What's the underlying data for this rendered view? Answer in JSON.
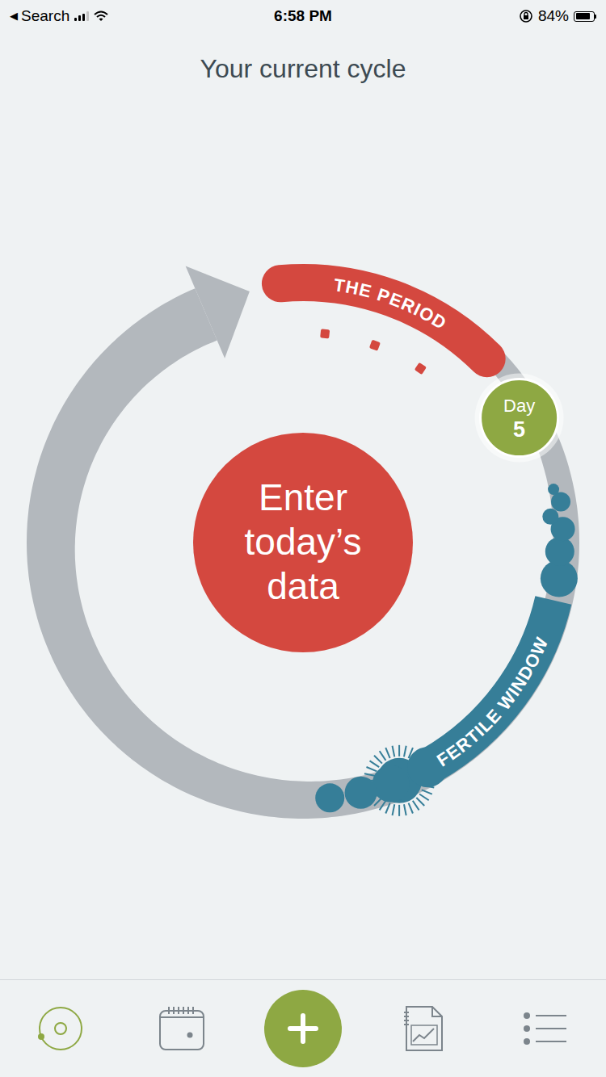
{
  "status_bar": {
    "back_icon": "◀",
    "back_label": "Search",
    "signal_bars": 3,
    "time": "6:58 PM",
    "battery_text": "84%",
    "battery_level": 0.84
  },
  "title": "Your current cycle",
  "cycle": {
    "period_label": "THE PERIOD",
    "fertile_label": "FERTILE WINDOW",
    "day_label": "Day",
    "day": "5",
    "enter_button": "Enter today’s data"
  },
  "tab_bar": [
    {
      "kind": "cycle",
      "selected": true
    },
    {
      "kind": "calendar",
      "selected": false
    },
    {
      "kind": "add",
      "selected": false
    },
    {
      "kind": "charts",
      "selected": false
    },
    {
      "kind": "menu",
      "selected": false
    }
  ]
}
